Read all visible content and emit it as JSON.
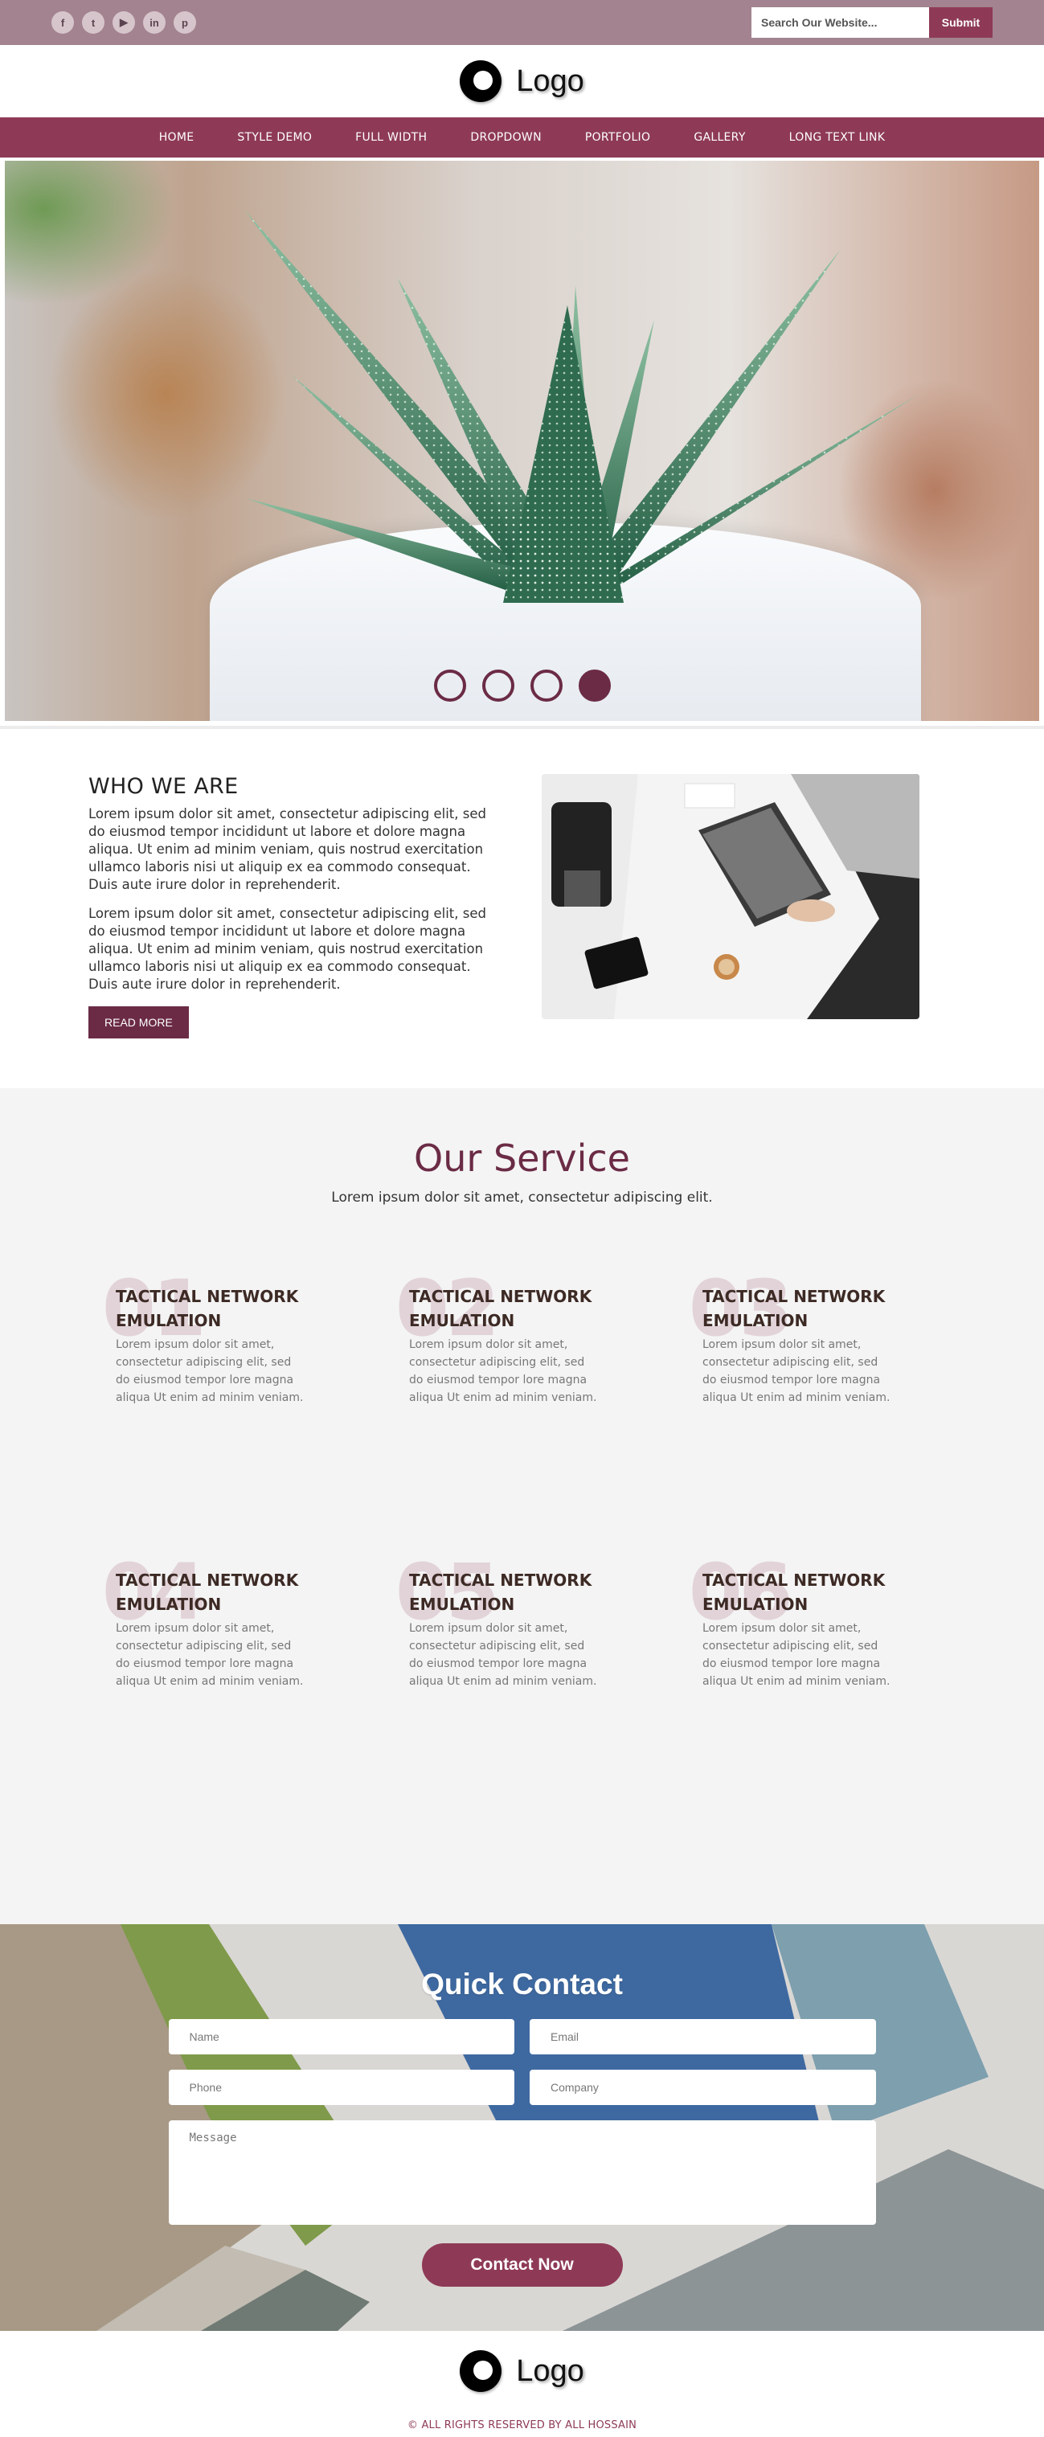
{
  "topbar": {
    "socials": [
      {
        "icon": "facebook-icon",
        "glyph": "f"
      },
      {
        "icon": "twitter-icon",
        "glyph": "t"
      },
      {
        "icon": "youtube-icon",
        "glyph": "▶"
      },
      {
        "icon": "linkedin-icon",
        "glyph": "in"
      },
      {
        "icon": "pinterest-icon",
        "glyph": "p"
      }
    ],
    "search_placeholder": "Search Our Website...",
    "submit_label": "Submit"
  },
  "header": {
    "logo_text": "Logo"
  },
  "nav": {
    "items": [
      "HOME",
      "STYLE DEMO",
      "FULL WIDTH",
      "DROPDOWN",
      "PORTFOLIO",
      "GALLERY",
      "LONG TEXT LINK"
    ]
  },
  "hero": {
    "slide_count": 4,
    "active_slide": 4
  },
  "about": {
    "title": "WHO WE ARE",
    "paragraphs": [
      "Lorem ipsum dolor sit amet, consectetur adipiscing elit, sed do eiusmod tempor incididunt ut labore et dolore magna aliqua. Ut enim ad minim veniam, quis nostrud exercitation ullamco laboris nisi ut aliquip ex ea commodo consequat. Duis aute irure dolor in reprehenderit.",
      "Lorem ipsum dolor sit amet, consectetur adipiscing elit, sed do eiusmod tempor incididunt ut labore et dolore magna aliqua. Ut enim ad minim veniam, quis nostrud exercitation ullamco laboris nisi ut aliquip ex ea commodo consequat. Duis aute irure dolor in reprehenderit."
    ],
    "button": "READ MORE"
  },
  "services": {
    "title": "Our Service",
    "subtitle": "Lorem ipsum dolor sit amet, consectetur adipiscing elit.",
    "items": [
      {
        "num": "01",
        "title": "TACTICAL NETWORK EMULATION",
        "text": "Lorem ipsum dolor sit amet, consectetur adipiscing elit, sed do eiusmod tempor lore magna aliqua Ut enim ad minim veniam."
      },
      {
        "num": "02",
        "title": "TACTICAL NETWORK EMULATION",
        "text": "Lorem ipsum dolor sit amet, consectetur adipiscing elit, sed do eiusmod tempor lore magna aliqua Ut enim ad minim veniam."
      },
      {
        "num": "03",
        "title": "TACTICAL NETWORK EMULATION",
        "text": "Lorem ipsum dolor sit amet, consectetur adipiscing elit, sed do eiusmod tempor lore magna aliqua Ut enim ad minim veniam."
      },
      {
        "num": "04",
        "title": "TACTICAL NETWORK EMULATION",
        "text": "Lorem ipsum dolor sit amet, consectetur adipiscing elit, sed do eiusmod tempor lore magna aliqua Ut enim ad minim veniam."
      },
      {
        "num": "05",
        "title": "TACTICAL NETWORK EMULATION",
        "text": "Lorem ipsum dolor sit amet, consectetur adipiscing elit, sed do eiusmod tempor lore magna aliqua Ut enim ad minim veniam."
      },
      {
        "num": "06",
        "title": "TACTICAL NETWORK EMULATION",
        "text": "Lorem ipsum dolor sit amet, consectetur adipiscing elit, sed do eiusmod tempor lore magna aliqua Ut enim ad minim veniam."
      }
    ]
  },
  "contact": {
    "title": "Quick Contact",
    "name_placeholder": "Name",
    "email_placeholder": "Email",
    "phone_placeholder": "Phone",
    "company_placeholder": "Company",
    "message_placeholder": "Message",
    "button": "Contact Now"
  },
  "footer": {
    "logo_text": "Logo",
    "copyright": "© ALL RIGHTS RESERVED BY ALL HOSSAIN"
  },
  "colors": {
    "topbar": "#a3838f",
    "brand": "#8e3a56",
    "brand_dark": "#6b2b45",
    "services_bg": "#f4f4f4"
  }
}
